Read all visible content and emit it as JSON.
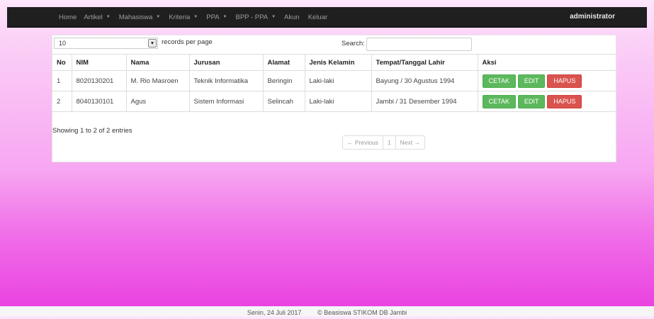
{
  "navbar": {
    "items": [
      {
        "label": "Home",
        "dropdown": false
      },
      {
        "label": "Artikel",
        "dropdown": true
      },
      {
        "label": "Mahasiswa",
        "dropdown": true
      },
      {
        "label": "Kriteria",
        "dropdown": true
      },
      {
        "label": "PPA",
        "dropdown": true
      },
      {
        "label": "BPP - PPA",
        "dropdown": true
      },
      {
        "label": "Akun",
        "dropdown": false
      },
      {
        "label": "Keluar",
        "dropdown": false
      }
    ],
    "user": "administrator"
  },
  "table_controls": {
    "length_value": "10",
    "length_label": "records per page",
    "search_label": "Search:",
    "search_value": ""
  },
  "table": {
    "headers": [
      "No",
      "NIM",
      "Nama",
      "Jurusan",
      "Alamat",
      "Jenis Kelamin",
      "Tempat/Tanggal Lahir",
      "Aksi"
    ],
    "rows": [
      [
        "1",
        "8020130201",
        "M. Rio Masroen",
        "Teknik Informatika",
        "Beringin",
        "Laki-laki",
        "Bayung / 30 Agustus 1994"
      ],
      [
        "2",
        "8040130101",
        "Agus",
        "Sistem Informasi",
        "Selincah",
        "Laki-laki",
        "Jambi / 31 Desember 1994"
      ]
    ],
    "actions": {
      "print": "CETAK",
      "edit": "EDIT",
      "delete": "HAPUS"
    }
  },
  "info": "Showing 1 to 2 of 2 entries",
  "pagination": {
    "previous": "← Previous",
    "current": "1",
    "next": "Next →"
  },
  "footer": {
    "date": "Senin, 24 Juli 2017",
    "copyright": "© Beasiswa STIKOM DB Jambi"
  }
}
